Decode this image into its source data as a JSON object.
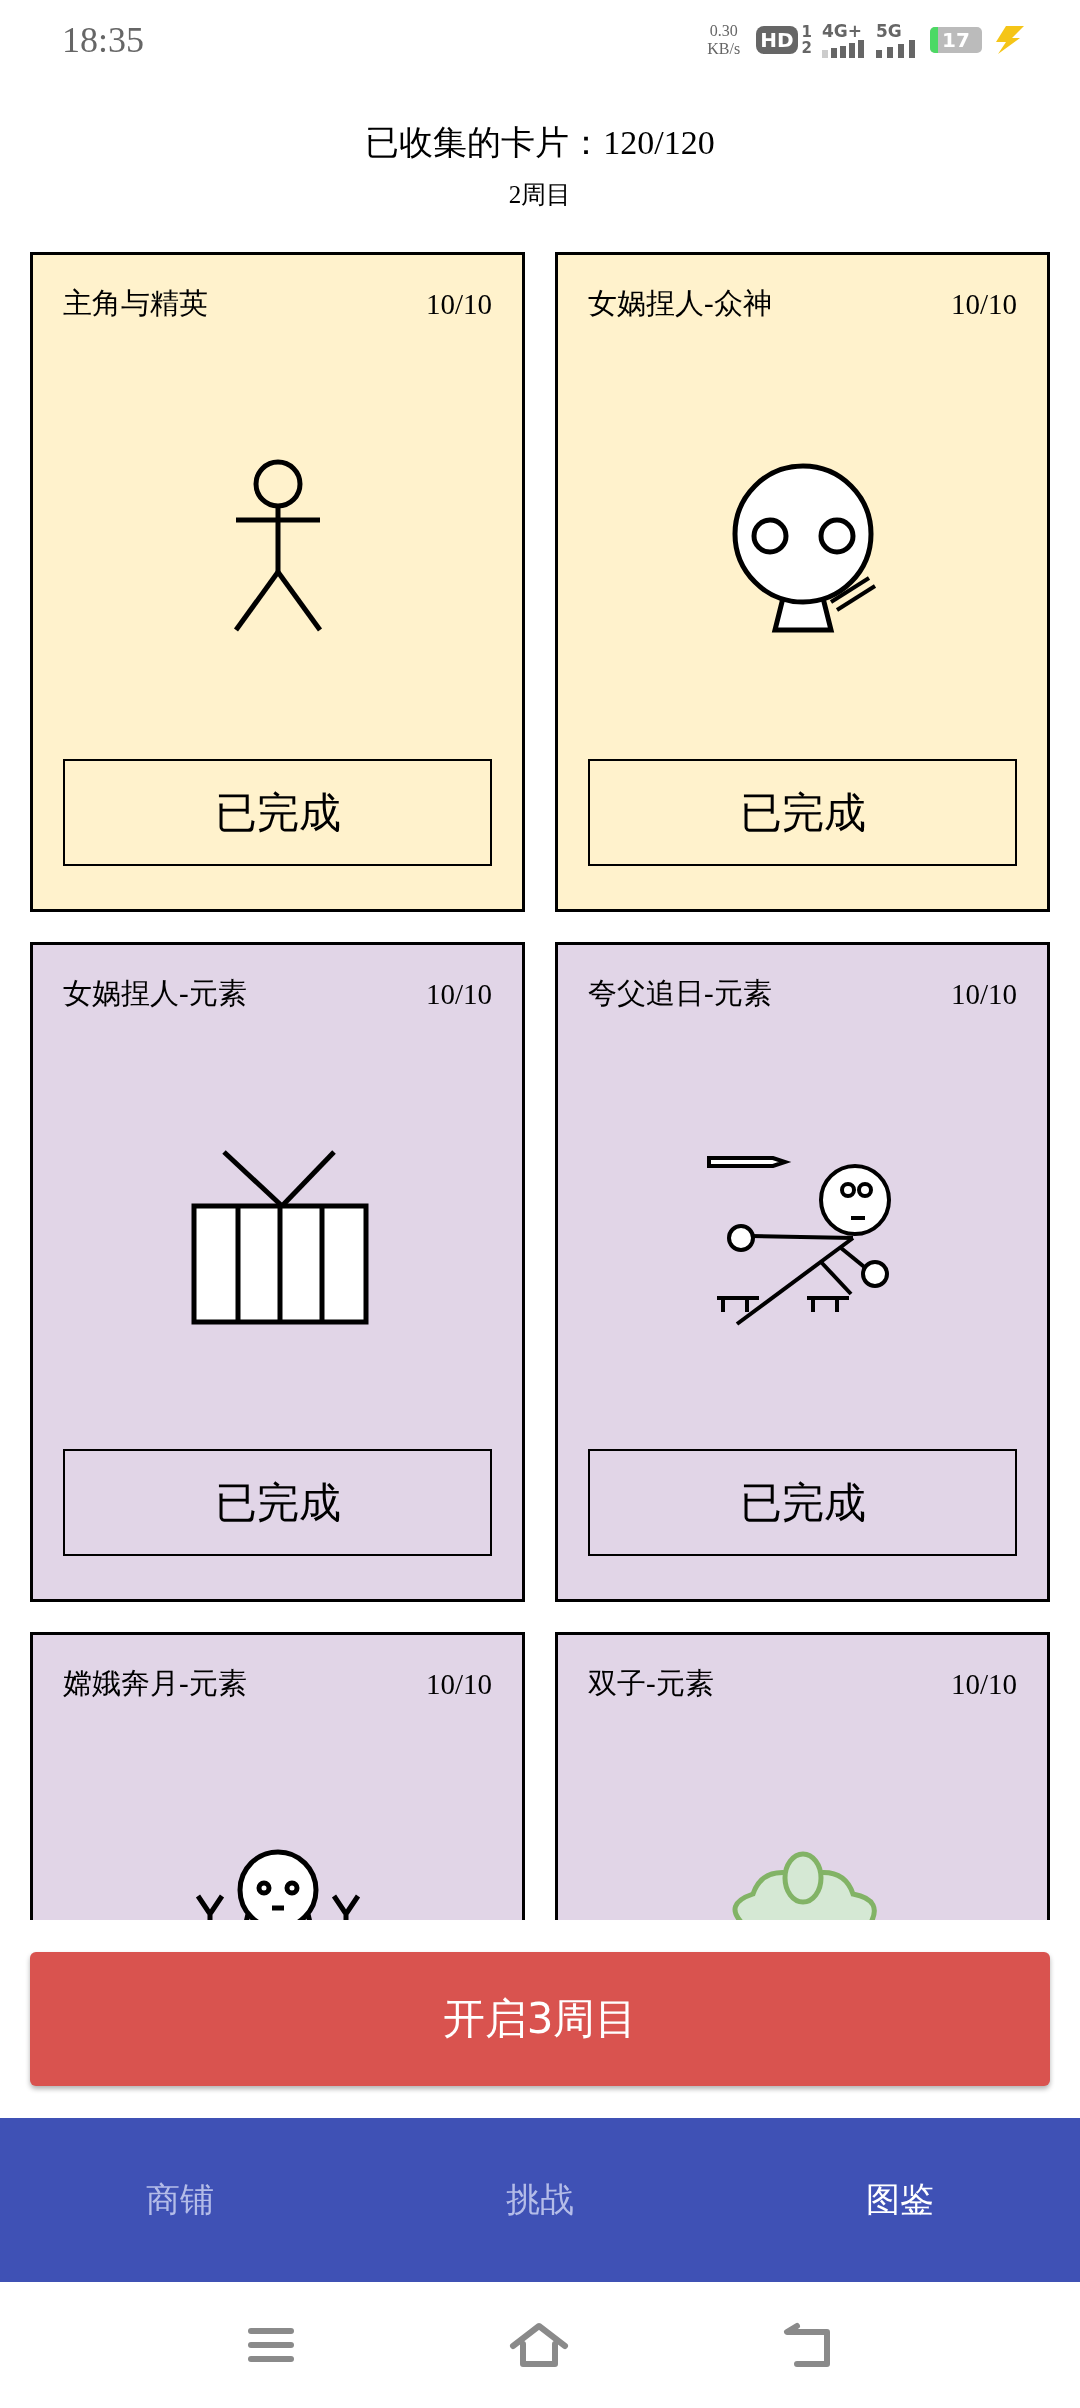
{
  "status_bar": {
    "time": "18:35",
    "speed": "0.30",
    "speed_unit": "KB/s",
    "hd": "HD",
    "sim_slots": [
      "1",
      "2"
    ],
    "network_1": "4G+",
    "network_2": "5G",
    "battery": "17"
  },
  "header": {
    "title": "已收集的卡片：120/120",
    "subtitle": "2周目"
  },
  "cards": [
    {
      "title": "主角与精英",
      "count": "10/10",
      "color": "#fff2cc",
      "status": "已完成"
    },
    {
      "title": "女娲捏人-众神",
      "count": "10/10",
      "color": "#fff2cc",
      "status": "已完成"
    },
    {
      "title": "女娲捏人-元素",
      "count": "10/10",
      "color": "#e1d5e7",
      "status": "已完成"
    },
    {
      "title": "夸父追日-元素",
      "count": "10/10",
      "color": "#e1d5e7",
      "status": "已完成"
    },
    {
      "title": "嫦娥奔月-元素",
      "count": "10/10",
      "color": "#e1d5e7"
    },
    {
      "title": "双子-元素",
      "count": "10/10",
      "color": "#e1d5e7"
    }
  ],
  "action_button": "开启3周目",
  "tabs": [
    {
      "label": "商铺",
      "selected": false
    },
    {
      "label": "挑战",
      "selected": false
    },
    {
      "label": "图鉴",
      "selected": true
    }
  ]
}
